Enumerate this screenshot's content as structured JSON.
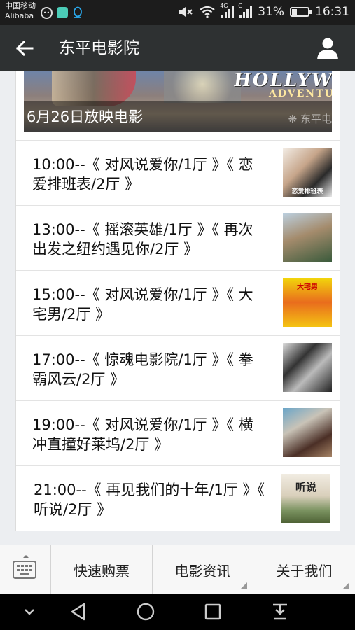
{
  "status_bar": {
    "carrier_line1": "中国移动",
    "carrier_line2": "Alibaba",
    "network_label_1": "4G",
    "network_label_2": "G",
    "battery_percent": "31%",
    "battery_level": 0.31,
    "time": "16:31"
  },
  "app_bar": {
    "title": "东平电影院",
    "back_icon": "arrow-left-icon",
    "profile_icon": "person-icon"
  },
  "banner": {
    "caption": "6月26日放映电影",
    "poster_title": "HOLLYWOO",
    "poster_subtitle": "ADVENTU",
    "watermark": "东平电"
  },
  "schedule": [
    {
      "text": "10:00--《 对风说爱你/1厅 》《 恋爱排班表/2厅 》",
      "thumb_label": "恋爱排班表"
    },
    {
      "text": "13:00--《 摇滚英雄/1厅 》《 再次出发之纽约遇见你/2厅 》",
      "thumb_label": ""
    },
    {
      "text": "15:00--《 对风说爱你/1厅 》《 大宅男/2厅 》",
      "thumb_label": "大宅男"
    },
    {
      "text": "17:00--《 惊魂电影院/1厅 》《 拳霸风云/2厅 》",
      "thumb_label": ""
    },
    {
      "text": "19:00--《 对风说爱你/1厅 》《 横冲直撞好莱坞/2厅 》",
      "thumb_label": ""
    },
    {
      "text": "21:00--《 再见我们的十年/1厅 》《 听说/2厅 》",
      "thumb_label": "听说"
    }
  ],
  "bottom_menu": {
    "keyboard_icon": "keyboard-icon",
    "items": [
      "快速购票",
      "电影资讯",
      "关于我们"
    ]
  },
  "nav_bar": {
    "icons": [
      "chevron-down-icon",
      "back-triangle-icon",
      "home-circle-icon",
      "recents-square-icon",
      "notification-pull-icon"
    ]
  }
}
